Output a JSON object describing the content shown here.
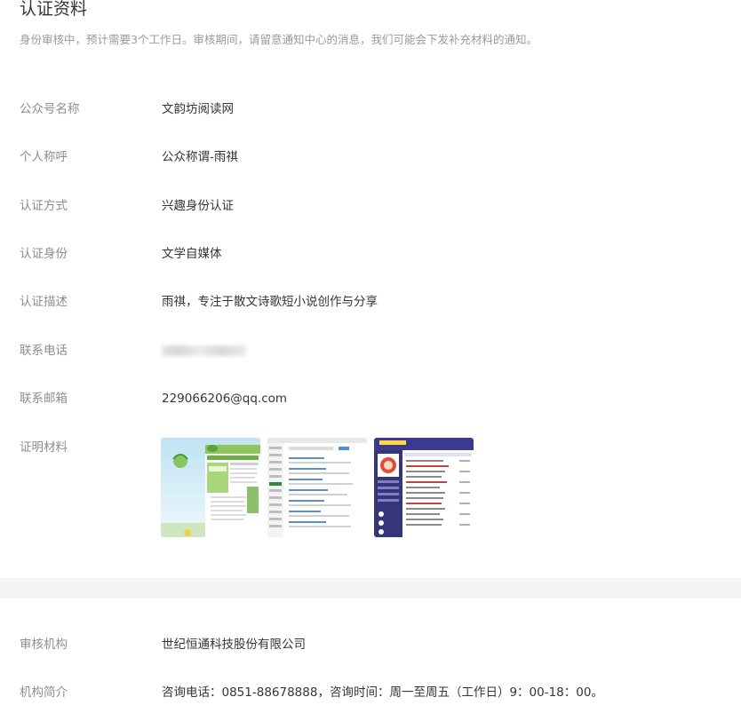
{
  "page": {
    "title": "认证资料",
    "subtitle": "身份审核中，预计需要3个工作日。审核期间，请留意通知中心的消息，我们可能会下发补充材料的通知。"
  },
  "fields": {
    "account_name": {
      "label": "公众号名称",
      "value": "文韵坊阅读网"
    },
    "nickname": {
      "label": "个人称呼",
      "value": "公众称谓-雨祺"
    },
    "method": {
      "label": "认证方式",
      "value": "兴趣身份认证"
    },
    "identity": {
      "label": "认证身份",
      "value": "文学自媒体"
    },
    "description": {
      "label": "认证描述",
      "value": "雨祺，专注于散文诗歌短小说创作与分享"
    },
    "phone": {
      "label": "联系电话",
      "value": ""
    },
    "email": {
      "label": "联系邮箱",
      "value": "229066206@qq.com"
    },
    "materials": {
      "label": "证明材料"
    }
  },
  "review": {
    "org": {
      "label": "审核机构",
      "value": "世纪恒通科技股份有限公司"
    },
    "intro": {
      "label": "机构简介",
      "value": "咨询电话：0851-88678888，咨询时间：周一至周五（工作日）9：00-18：00。"
    }
  },
  "colors": {
    "label": "#8d8d8d",
    "text": "#353535",
    "subtitle": "#9a9a9a",
    "divider": "#f4f5f7"
  }
}
